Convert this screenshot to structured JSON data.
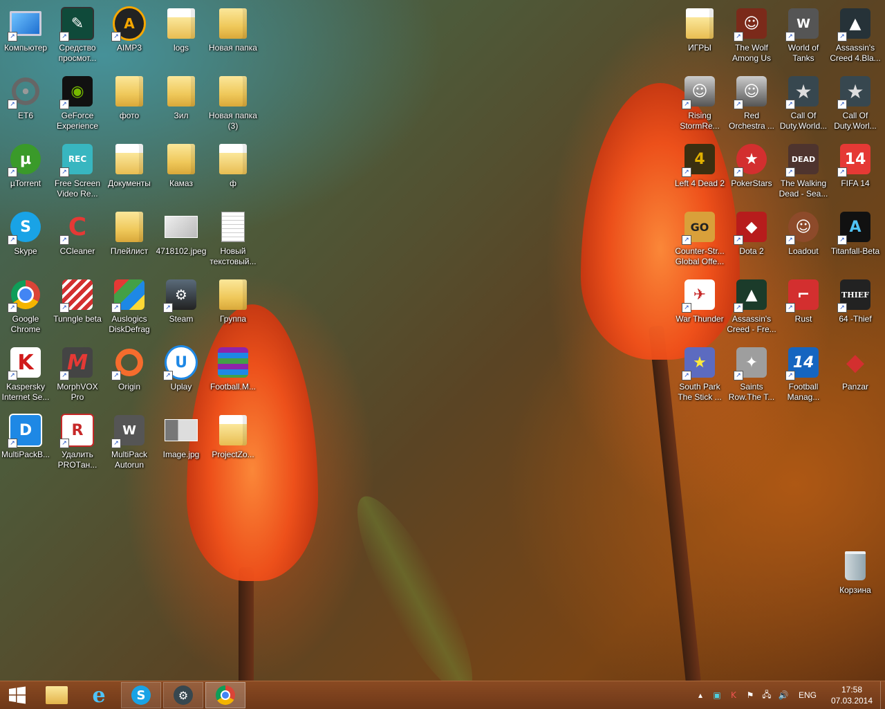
{
  "desktop": {
    "icons": [
      {
        "label": "Компьютер",
        "icon": "computer-icon"
      },
      {
        "label": "Средство просмот...",
        "icon": "photo-viewer-icon"
      },
      {
        "label": "AIMP3",
        "icon": "aimp-icon"
      },
      {
        "label": "logs",
        "icon": "folder-icon"
      },
      {
        "label": "Новая папка",
        "icon": "folder-icon"
      },
      {
        "label": "ET6",
        "icon": "steering-wheel-icon"
      },
      {
        "label": "GeForce Experience",
        "icon": "geforce-icon"
      },
      {
        "label": "фото",
        "icon": "folder-icon"
      },
      {
        "label": "Зил",
        "icon": "folder-icon"
      },
      {
        "label": "Новая папка (3)",
        "icon": "folder-icon"
      },
      {
        "label": "µTorrent",
        "icon": "utorrent-icon"
      },
      {
        "label": "Free Screen Video Re...",
        "icon": "screen-recorder-icon"
      },
      {
        "label": "Документы",
        "icon": "folder-icon"
      },
      {
        "label": "Камаз",
        "icon": "folder-icon"
      },
      {
        "label": "ф",
        "icon": "folder-icon"
      },
      {
        "label": "Skype",
        "icon": "skype-icon"
      },
      {
        "label": "CCleaner",
        "icon": "ccleaner-icon"
      },
      {
        "label": "Плейлист",
        "icon": "folder-icon"
      },
      {
        "label": "4718102.jpeg",
        "icon": "image-file-icon"
      },
      {
        "label": "Новый текстовый...",
        "icon": "text-file-icon"
      },
      {
        "label": "Google Chrome",
        "icon": "chrome-icon"
      },
      {
        "label": "Tunngle beta",
        "icon": "tunngle-icon"
      },
      {
        "label": "Auslogics DiskDefrag",
        "icon": "defrag-icon"
      },
      {
        "label": "Steam",
        "icon": "steam-icon"
      },
      {
        "label": "Группа",
        "icon": "folder-icon"
      },
      {
        "label": "Kaspersky Internet Se...",
        "icon": "kaspersky-icon"
      },
      {
        "label": "MorphVOX Pro",
        "icon": "morphvox-icon"
      },
      {
        "label": "Origin",
        "icon": "origin-icon"
      },
      {
        "label": "Uplay",
        "icon": "uplay-icon"
      },
      {
        "label": "Football.M...",
        "icon": "winrar-icon"
      },
      {
        "label": "MultiPackB...",
        "icon": "multipack-icon"
      },
      {
        "label": "Удалить PROTан...",
        "icon": "uninstall-icon"
      },
      {
        "label": "MultiPack Autorun",
        "icon": "world-of-tanks-icon"
      },
      {
        "label": "Image.jpg",
        "icon": "image-file-icon"
      },
      {
        "label": "ProjectZo...",
        "icon": "folder-icon"
      },
      {
        "label": "ИГРЫ",
        "icon": "folder-icon"
      },
      {
        "label": "The Wolf Among Us",
        "icon": "wolf-among-us-icon"
      },
      {
        "label": "World of Tanks",
        "icon": "world-of-tanks-icon"
      },
      {
        "label": "Assassin's Creed 4.Bla...",
        "icon": "assassins-creed-icon"
      },
      {
        "label": "Rising StormRe...",
        "icon": "soldier-icon"
      },
      {
        "label": "Red Orchestra ...",
        "icon": "soldier-icon"
      },
      {
        "label": "Call Of Duty.World...",
        "icon": "star-icon"
      },
      {
        "label": "Call Of Duty.Worl...",
        "icon": "star-icon"
      },
      {
        "label": "Left 4 Dead 2",
        "icon": "left4dead-icon"
      },
      {
        "label": "PokerStars",
        "icon": "pokerstars-icon"
      },
      {
        "label": "The Walking Dead - Sea...",
        "icon": "walking-dead-icon"
      },
      {
        "label": "FIFA 14",
        "icon": "fifa-icon"
      },
      {
        "label": "Counter-Str... Global Offe...",
        "icon": "csgo-icon"
      },
      {
        "label": "Dota 2",
        "icon": "dota-icon"
      },
      {
        "label": "Loadout",
        "icon": "loadout-icon"
      },
      {
        "label": "Titanfall-Beta",
        "icon": "titanfall-icon"
      },
      {
        "label": "War Thunder",
        "icon": "war-thunder-icon"
      },
      {
        "label": "Assassin's Creed - Fre...",
        "icon": "assassins-creed-icon"
      },
      {
        "label": "Rust",
        "icon": "rust-icon"
      },
      {
        "label": "64 -Thief",
        "icon": "thief-icon"
      },
      {
        "label": "South Park The Stick ...",
        "icon": "south-park-icon"
      },
      {
        "label": "Saints Row.The T...",
        "icon": "saints-row-icon"
      },
      {
        "label": "Football Manag...",
        "icon": "football-manager-icon"
      },
      {
        "label": "Panzar",
        "icon": "panzar-icon"
      },
      {
        "label": "Корзина",
        "icon": "recycle-bin-icon"
      }
    ]
  },
  "taskbar": {
    "pinned": [
      {
        "name": "start-button",
        "icon": "windows-logo-icon"
      },
      {
        "name": "file-explorer",
        "icon": "file-explorer-icon"
      },
      {
        "name": "internet-explorer",
        "icon": "internet-explorer-icon"
      },
      {
        "name": "skype",
        "icon": "skype-icon"
      },
      {
        "name": "steam",
        "icon": "steam-icon"
      },
      {
        "name": "google-chrome",
        "icon": "chrome-icon"
      }
    ],
    "language": "ENG",
    "time": "17:58",
    "date": "07.03.2014"
  },
  "colors": {
    "taskbar": "#7a4020",
    "folder": "#efc85a",
    "label_text": "#ffffff"
  }
}
